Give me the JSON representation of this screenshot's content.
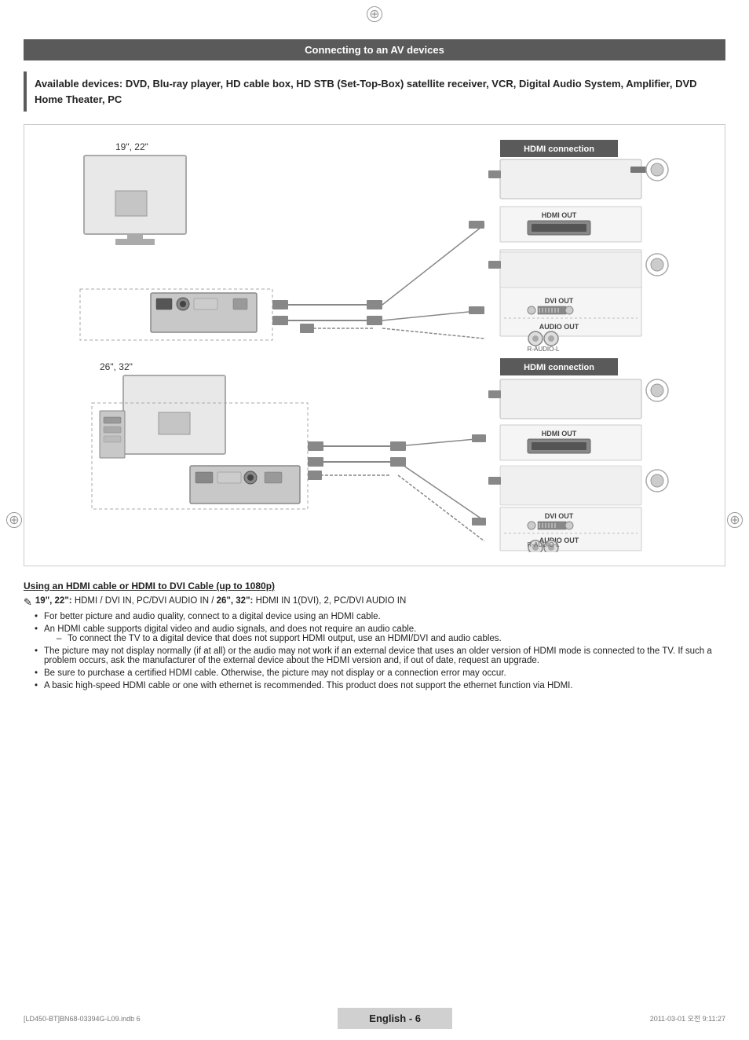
{
  "page": {
    "title": "Connecting to an AV devices",
    "available_notice": "Available devices: DVD, Blu-ray player, HD cable box, HD STB (Set-Top-Box) satellite receiver, VCR, Digital Audio System, Amplifier, DVD Home Theater, PC",
    "section1_label": "19\", 22\"",
    "section2_label": "26\", 32\"",
    "hdmi_connection_label": "HDMI connection",
    "hdmi_out_label": "HDMI OUT",
    "dvi_out_label": "DVI OUT",
    "audio_out_label": "AUDIO OUT",
    "r_audio_l_label": "R-AUDIO-L",
    "cable_heading": "Using an HDMI cable or HDMI to DVI Cable (up to 1080p)",
    "note_line": "19\", 22\": HDMI / DVI IN, PC/DVI AUDIO IN / 26\", 32\": HDMI IN 1(DVI), 2, PC/DVI AUDIO IN",
    "bullets": [
      "For better picture and audio quality, connect to a digital device using an HDMI cable.",
      "An HDMI cable supports digital video and audio signals, and does not require an audio cable.",
      "To connect the TV to a digital device that does not support HDMI output, use an HDMI/DVI and audio cables.",
      "The picture may not display normally (if at all) or the audio may not work if an external device that uses an older version of HDMI mode is connected to the TV. If such a problem occurs, ask the manufacturer of the external device about the HDMI version and, if out of date, request an upgrade.",
      "Be sure to purchase a certified HDMI cable. Otherwise, the picture may not display or a connection error may occur.",
      "A basic high-speed HDMI cable or one with ethernet is recommended. This product does not support the ethernet function via HDMI."
    ],
    "footer": {
      "left": "[LD450-BT]BN68-03394G-L09.indb   6",
      "center": "English - 6",
      "right": "2011-03-01   오전 9:11:27"
    }
  }
}
